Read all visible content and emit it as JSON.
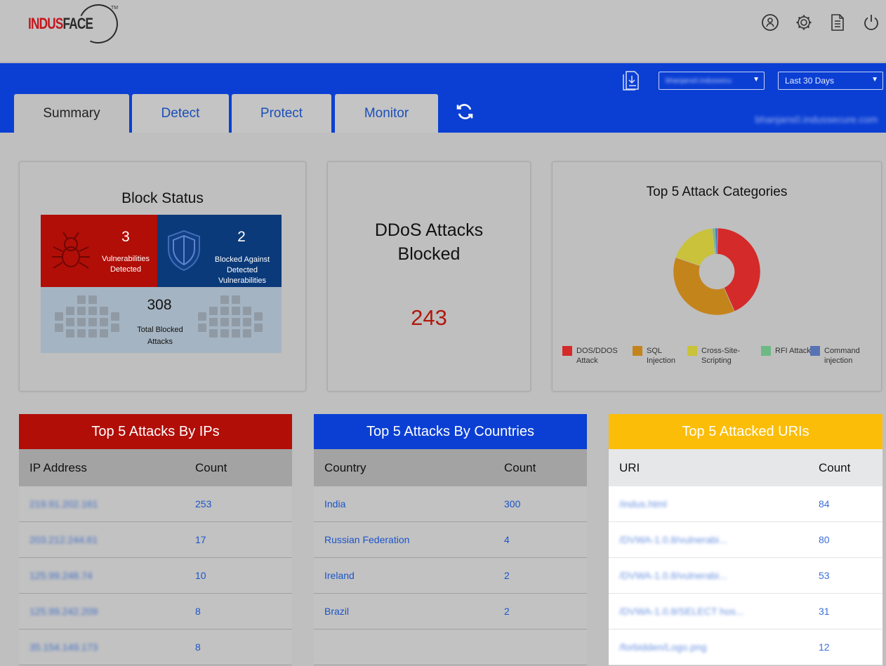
{
  "brand": {
    "logo_part1": "INDUS",
    "logo_part2": "FACE",
    "logo_tm": "TM"
  },
  "top_icons": [
    "user-icon",
    "gear-icon",
    "document-icon",
    "power-icon"
  ],
  "nav": {
    "tabs": [
      {
        "label": "Summary",
        "active": true
      },
      {
        "label": "Detect",
        "active": false
      },
      {
        "label": "Protect",
        "active": false
      },
      {
        "label": "Monitor",
        "active": false
      }
    ],
    "site_select": "bhanjans0.indussecu",
    "range_select": "Last 30 Days",
    "site_name": "bhanjans0.indussecure.com"
  },
  "block_status": {
    "title": "Block Status",
    "vulnerabilities_count": "3",
    "vulnerabilities_label": "Vulnerabilities Detected",
    "blocked_against_count": "2",
    "blocked_against_label": "Blocked Against Detected Vulnerabilities",
    "total_blocked_count": "308",
    "total_blocked_label": "Total Blocked Attacks"
  },
  "ddos": {
    "title": "DDoS Attacks Blocked",
    "value": "243"
  },
  "chart_data": {
    "type": "pie",
    "title": "Top 5 Attack Categories",
    "categories": [
      "DOS/DDOS Attack",
      "SQL Injection",
      "Cross-Site-Scripting",
      "RFI Attacks",
      "Command injection"
    ],
    "values": [
      43,
      37,
      18,
      1,
      1
    ],
    "colors": [
      "#d42a2a",
      "#c4841c",
      "#c9c23a",
      "#6cb985",
      "#5873b4"
    ],
    "donut": true,
    "legend_position": "bottom"
  },
  "top_ips": {
    "title": "Top 5 Attacks By IPs",
    "columns": [
      "IP Address",
      "Count"
    ],
    "rows": [
      [
        "219.91.202.161",
        "253"
      ],
      [
        "203.212.244.61",
        "17"
      ],
      [
        "125.99.248.74",
        "10"
      ],
      [
        "125.99.242.209",
        "8"
      ],
      [
        "35.154.149.173",
        "8"
      ]
    ]
  },
  "top_countries": {
    "title": "Top 5 Attacks By Countries",
    "columns": [
      "Country",
      "Count"
    ],
    "rows": [
      [
        "India",
        "300"
      ],
      [
        "Russian Federation",
        "4"
      ],
      [
        "Ireland",
        "2"
      ],
      [
        "Brazil",
        "2"
      ],
      [
        "",
        ""
      ]
    ]
  },
  "top_uris": {
    "title": "Top 5 Attacked URIs",
    "columns": [
      "URI",
      "Count"
    ],
    "rows": [
      [
        "/indus.html",
        "84"
      ],
      [
        "/DVWA-1.0.8/vulnerabi...",
        "80"
      ],
      [
        "/DVWA-1.0.8/vulnerabi...",
        "53"
      ],
      [
        "/DVWA-1.0.8/SELECT hos...",
        "31"
      ],
      [
        "/forbidden/Logo.png",
        "12"
      ]
    ]
  }
}
